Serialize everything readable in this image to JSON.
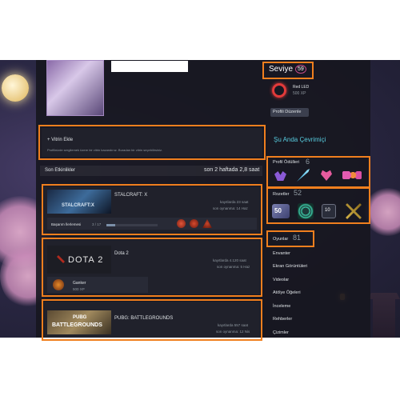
{
  "profile": {
    "level_label": "Seviye",
    "level_value": "59",
    "xp_badge_name": "Red LED",
    "xp_badge_xp": "500 XP",
    "edit_button": "Profili Düzenle"
  },
  "showcase": {
    "title": "+ Vitrin Ekle",
    "desc": "Profilinizde sergilemek üzere bir vitrin kazandınız. Buradan bir vitrin seçebilirsiniz."
  },
  "activity": {
    "title": "Son Etkinlikler",
    "summary": "son 2 haftada 2,8 saat",
    "games": [
      {
        "name": "STALCRAFT: X",
        "thumb_text": "STALCRAFT:X",
        "hours": "kayıtlarda 23 saat",
        "last": "son oynanma: 14 Haz",
        "progress_label": "Başarım İlerlemesi",
        "progress_value": "3 / 17"
      },
      {
        "name": "Dota 2",
        "thumb_text": "DOTA 2",
        "hours": "kayıtlarda 4.120 saat",
        "last": "son oynanma: 5 Haz",
        "badge_name": "Ganker",
        "badge_xp": "500 XP"
      },
      {
        "name": "PUBG: BATTLEGROUNDS",
        "thumb_text": "BATTLEGROUNDS",
        "thumb_sub": "PUBG",
        "hours": "kayıtlarda 557 saat",
        "last": "son oynanma: 12 Nis"
      }
    ]
  },
  "sidebar": {
    "online_status": "Şu Anda Çevrimiçi",
    "awards_label": "Profil Ödülleri",
    "awards_count": "6",
    "badges_label": "Rozetler",
    "badges_count": "52",
    "badge_50_text": "50",
    "badge_10_text": "10",
    "games_label": "Oyunlar",
    "games_count": "81",
    "links": [
      "Envanter",
      "Ekran Görüntüleri",
      "Videolar",
      "Atölye Öğeleri",
      "İnceleme",
      "Rehberler",
      "Çizimler"
    ]
  },
  "colors": {
    "highlight": "#f07f1e",
    "online": "#57cbde",
    "panel": "#20212b",
    "text": "#dfe3e6",
    "muted": "#8f98a0",
    "level_ring": "#c44a8a",
    "red_led": "#e23a3a"
  }
}
